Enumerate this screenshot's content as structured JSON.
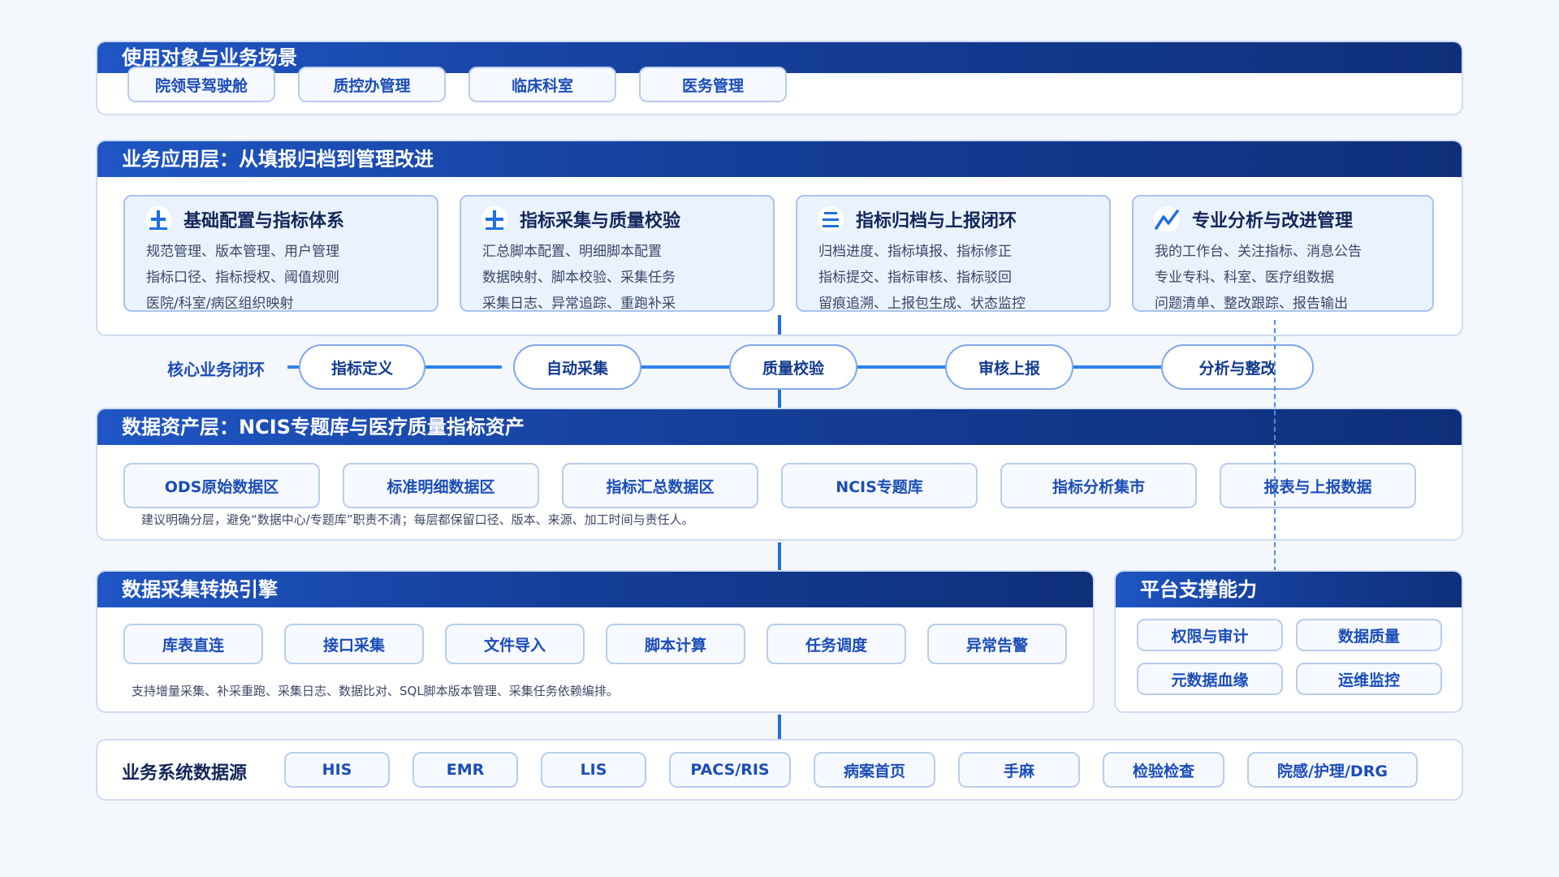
{
  "layer_users": {
    "title": "使用对象与业务场景",
    "tags": [
      "院领导驾驶舱",
      "质控办管理",
      "临床科室",
      "医务管理"
    ]
  },
  "layer_app": {
    "title": "业务应用层：从填报归档到管理改进",
    "cards": [
      {
        "icon": "plus-icon",
        "title": "基础配置与指标体系",
        "lines": [
          "规范管理、版本管理、用户管理",
          "指标口径、指标授权、阈值规则",
          "医院/科室/病区组织映射"
        ]
      },
      {
        "icon": "plus-icon",
        "title": "指标采集与质量校验",
        "lines": [
          "汇总脚本配置、明细脚本配置",
          "数据映射、脚本校验、采集任务",
          "采集日志、异常追踪、重跑补采"
        ]
      },
      {
        "icon": "menu-icon",
        "title": "指标归档与上报闭环",
        "lines": [
          "归档进度、指标填报、指标修正",
          "指标提交、指标审核、指标驳回",
          "留痕追溯、上报包生成、状态监控"
        ]
      },
      {
        "icon": "trend-icon",
        "title": "专业分析与改进管理",
        "lines": [
          "我的工作台、关注指标、消息公告",
          "专业专科、科室、医疗组数据",
          "问题清单、整改跟踪、报告输出"
        ]
      }
    ]
  },
  "core_loop": {
    "label": "核心业务闭环",
    "steps": [
      "指标定义",
      "自动采集",
      "质量校验",
      "审核上报",
      "分析与整改"
    ]
  },
  "layer_data": {
    "title": "数据资产层：NCIS专题库与医疗质量指标资产",
    "zones": [
      "ODS原始数据区",
      "标准明细数据区",
      "指标汇总数据区",
      "NCIS专题库",
      "指标分析集市",
      "报表与上报数据"
    ],
    "note": "建议明确分层，避免“数据中心/专题库”职责不清；每层都保留口径、版本、来源、加工时间与责任人。"
  },
  "layer_engine": {
    "title": "数据采集转换引擎",
    "items": [
      "库表直连",
      "接口采集",
      "文件导入",
      "脚本计算",
      "任务调度",
      "异常告警"
    ],
    "note": "支持增量采集、补采重跑、采集日志、数据比对、SQL脚本版本管理、采集任务依赖编排。"
  },
  "layer_platform": {
    "title": "平台支撑能力",
    "items": [
      "权限与审计",
      "数据质量",
      "元数据血缘",
      "运维监控"
    ]
  },
  "layer_sources": {
    "title": "业务系统数据源",
    "items": [
      "HIS",
      "EMR",
      "LIS",
      "PACS/RIS",
      "病案首页",
      "手麻",
      "检验检查",
      "院感/护理/DRG"
    ]
  },
  "colors": {
    "header_dark": "#0f2f7a",
    "header_light": "#1f56c4",
    "accent": "#1e6fe0",
    "card_bg": "#eaf2fe"
  }
}
